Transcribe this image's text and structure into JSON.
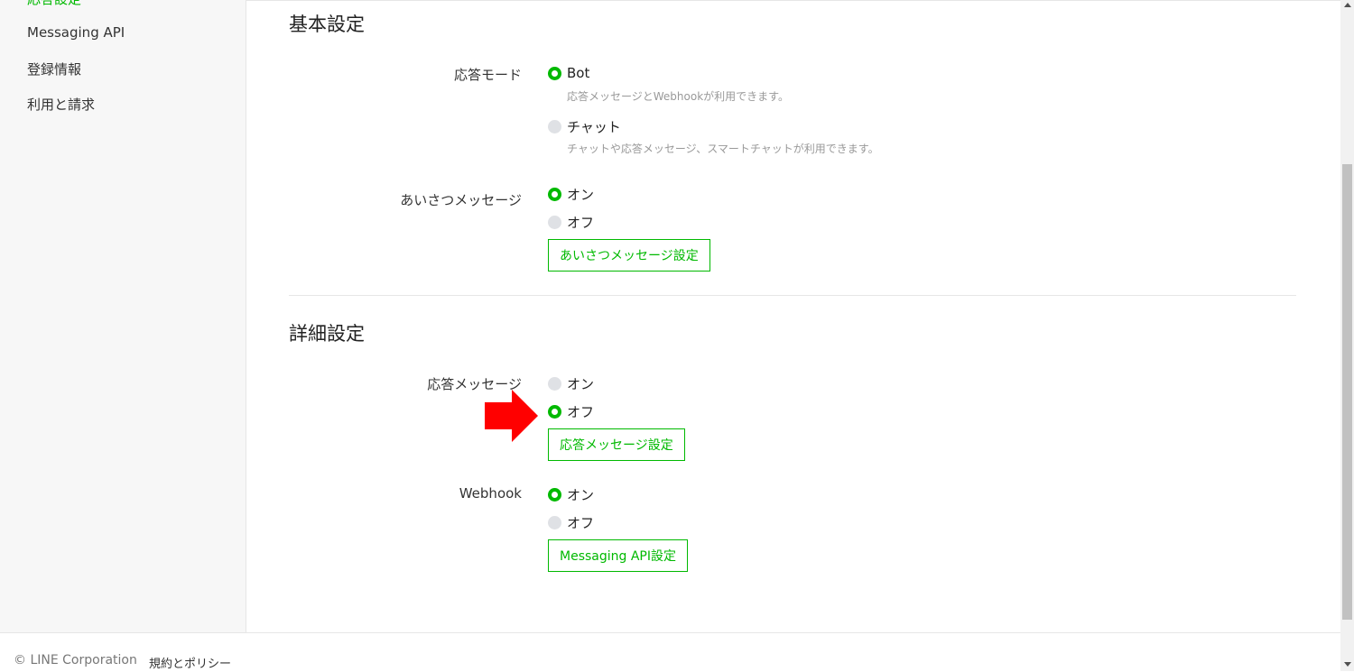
{
  "sidebar": {
    "items": [
      {
        "label": "応答設定"
      },
      {
        "label": "Messaging API"
      },
      {
        "label": "登録情報"
      },
      {
        "label": "利用と請求"
      }
    ]
  },
  "basic": {
    "title": "基本設定",
    "response_mode": {
      "label": "応答モード",
      "options": [
        {
          "label": "Bot",
          "desc": "応答メッセージとWebhookが利用できます。",
          "selected": true
        },
        {
          "label": "チャット",
          "desc": "チャットや応答メッセージ、スマートチャットが利用できます。",
          "selected": false
        }
      ]
    },
    "greeting": {
      "label": "あいさつメッセージ",
      "options": [
        {
          "label": "オン",
          "selected": true
        },
        {
          "label": "オフ",
          "selected": false
        }
      ],
      "button": "あいさつメッセージ設定"
    }
  },
  "advanced": {
    "title": "詳細設定",
    "auto_reply": {
      "label": "応答メッセージ",
      "options": [
        {
          "label": "オン",
          "selected": false
        },
        {
          "label": "オフ",
          "selected": true
        }
      ],
      "button": "応答メッセージ設定"
    },
    "webhook": {
      "label": "Webhook",
      "options": [
        {
          "label": "オン",
          "selected": true
        },
        {
          "label": "オフ",
          "selected": false
        }
      ],
      "button": "Messaging API設定"
    }
  },
  "footer": {
    "copyright": "© LINE Corporation",
    "policy": "規約とポリシー"
  },
  "colors": {
    "accent": "#00b900",
    "arrow": "#ff0000",
    "radio_off": "#dfe1e5"
  },
  "icons": {
    "annotation": "red-arrow-right-icon"
  }
}
